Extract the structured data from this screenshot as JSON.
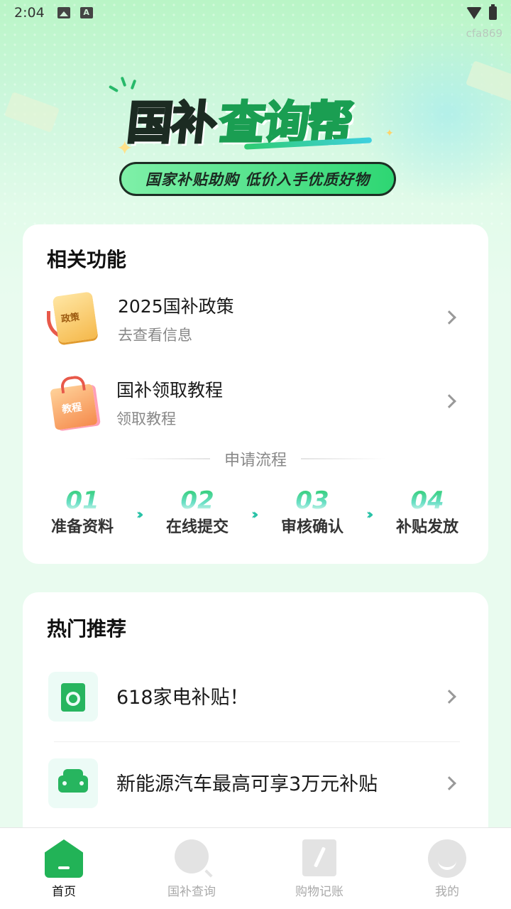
{
  "status_bar": {
    "time": "2:04",
    "watermark": "cfa869"
  },
  "hero": {
    "title_part1": "国补",
    "title_part2": "查询帮",
    "slogan": "国家补贴助购 低价入手优质好物"
  },
  "features_card": {
    "heading": "相关功能",
    "items": [
      {
        "title": "2025国补政策",
        "subtitle": "去查看信息",
        "icon": "policy-document-icon"
      },
      {
        "title": "国补领取教程",
        "subtitle": "领取教程",
        "icon": "tutorial-bag-icon"
      }
    ],
    "process_title": "申请流程",
    "steps": [
      {
        "num": "01",
        "label": "准备资料"
      },
      {
        "num": "02",
        "label": "在线提交"
      },
      {
        "num": "03",
        "label": "审核确认"
      },
      {
        "num": "04",
        "label": "补贴发放"
      }
    ]
  },
  "hot_card": {
    "heading": "热门推荐",
    "items": [
      {
        "title": "618家电补贴！",
        "icon": "washing-machine-icon"
      },
      {
        "title": "新能源汽车最高可享3万元补贴",
        "icon": "car-icon"
      }
    ]
  },
  "tab_bar": {
    "tabs": [
      {
        "label": "首页",
        "icon": "home-icon",
        "active": true
      },
      {
        "label": "国补查询",
        "icon": "search-icon",
        "active": false
      },
      {
        "label": "购物记账",
        "icon": "notebook-icon",
        "active": false
      },
      {
        "label": "我的",
        "icon": "profile-icon",
        "active": false
      }
    ]
  },
  "colors": {
    "brand_green": "#22b357",
    "accent_teal": "#27c2a6",
    "background": "#e9fbef"
  }
}
